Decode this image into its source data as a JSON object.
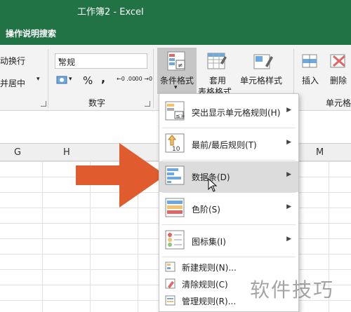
{
  "window": {
    "title": "工作簿2  -  Excel"
  },
  "tellbar": {
    "label": "操作说明搜索"
  },
  "ribbon": {
    "wrap_text": "动换行",
    "merge_center": "并居中",
    "number_format": "常规",
    "percent": "%",
    "comma": ",",
    "dec_inc": "←0 .00",
    "dec_dec": ".00 →0",
    "number_group": "数字",
    "cond_format": "条件格式",
    "table_format_1": "套用",
    "table_format_2": "表格格式",
    "cell_style": "单元格样式",
    "insert": "插入",
    "delete": "删除",
    "cells_group": "单元格"
  },
  "columns": [
    "G",
    "H",
    "M"
  ],
  "menu": {
    "items": [
      {
        "label": "突出显示单元格规则(H)"
      },
      {
        "label": "最前/最后规则(T)"
      },
      {
        "label": "数据条(D)"
      },
      {
        "label": "色阶(S)"
      },
      {
        "label": "图标集(I)"
      }
    ],
    "small_items": [
      {
        "label": "新建规则(N)..."
      },
      {
        "label": "清除规则(C)"
      },
      {
        "label": "管理规则(R)..."
      }
    ]
  },
  "watermark": "软件技巧",
  "colors": {
    "excel_green": "#217346",
    "arrow": "#e05c2e"
  }
}
